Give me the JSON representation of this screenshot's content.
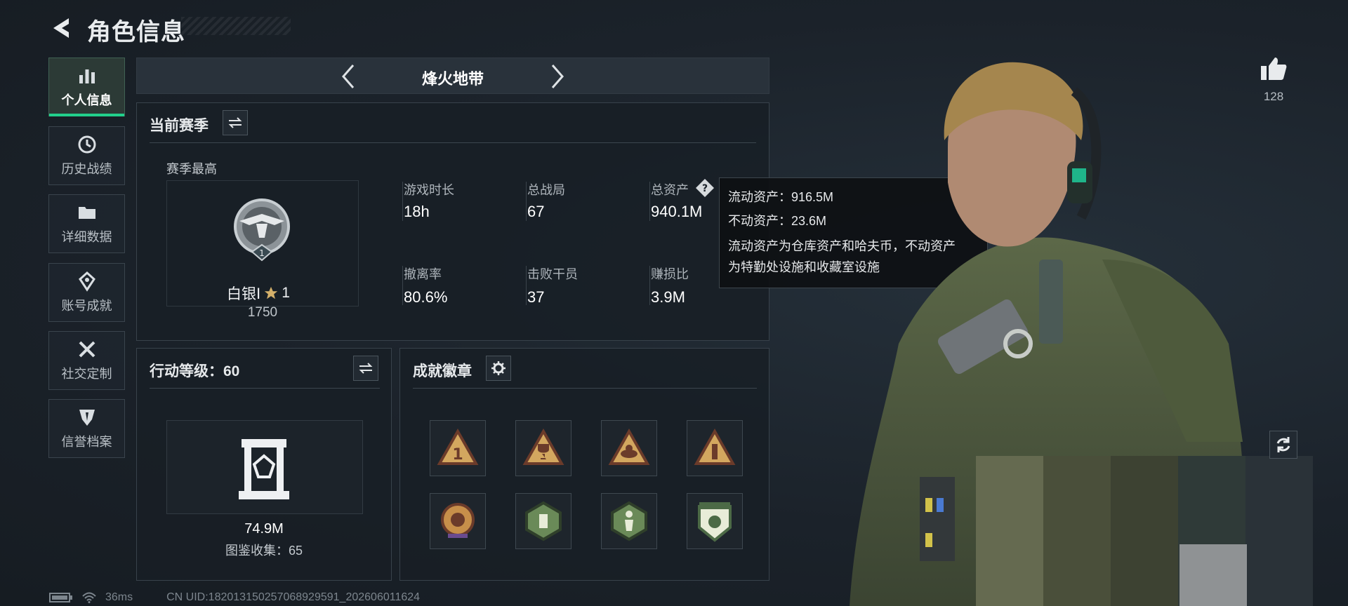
{
  "header": {
    "title": "角色信息"
  },
  "sidebar": {
    "items": [
      {
        "label": "个人信息",
        "active": true,
        "icon": "bar-chart-icon"
      },
      {
        "label": "历史战绩",
        "active": false,
        "icon": "history-icon"
      },
      {
        "label": "详细数据",
        "active": false,
        "icon": "folder-icon"
      },
      {
        "label": "账号成就",
        "active": false,
        "icon": "achievement-icon"
      },
      {
        "label": "社交定制",
        "active": false,
        "icon": "tools-icon"
      },
      {
        "label": "信誉档案",
        "active": false,
        "icon": "shield-icon"
      }
    ]
  },
  "mode": {
    "title": "烽火地带"
  },
  "season": {
    "title": "当前赛季",
    "best_label": "赛季最高",
    "rank_name": "白银Ⅰ",
    "rank_stars": "1",
    "rank_points": "1750",
    "stats": [
      {
        "label": "游戏时长",
        "value": "18h"
      },
      {
        "label": "总战局",
        "value": "67"
      },
      {
        "label": "总资产",
        "value": "940.1M"
      },
      {
        "label": "撤离率",
        "value": "80.6%"
      },
      {
        "label": "击败干员",
        "value": "37"
      },
      {
        "label": "赚损比",
        "value": "3.9M"
      }
    ]
  },
  "tooltip": {
    "liquid": "流动资产：916.5M",
    "fixed": "不动资产：23.6M",
    "desc_line1": "流动资产为仓库资产和哈夫币，不动资产",
    "desc_line2": "为特勤处设施和收藏室设施"
  },
  "action_level": {
    "title": "行动等级：60",
    "value": "74.9M",
    "collection": "图鉴收集：65"
  },
  "achievements": {
    "title": "成就徽章",
    "badges": [
      "badge-rank-one-icon",
      "badge-trophy-icon",
      "badge-loot-icon",
      "badge-bottle-icon",
      "badge-emblem-icon",
      "badge-medic-icon",
      "badge-runner-icon",
      "badge-shield-icon"
    ]
  },
  "likes": {
    "count": "128"
  },
  "footer": {
    "ping": "36ms",
    "uid": "CN UID:18201315025706892959​1_202606011624"
  },
  "colors": {
    "accent": "#22d08c",
    "panel": "#181f26",
    "text": "#d6dadd"
  }
}
